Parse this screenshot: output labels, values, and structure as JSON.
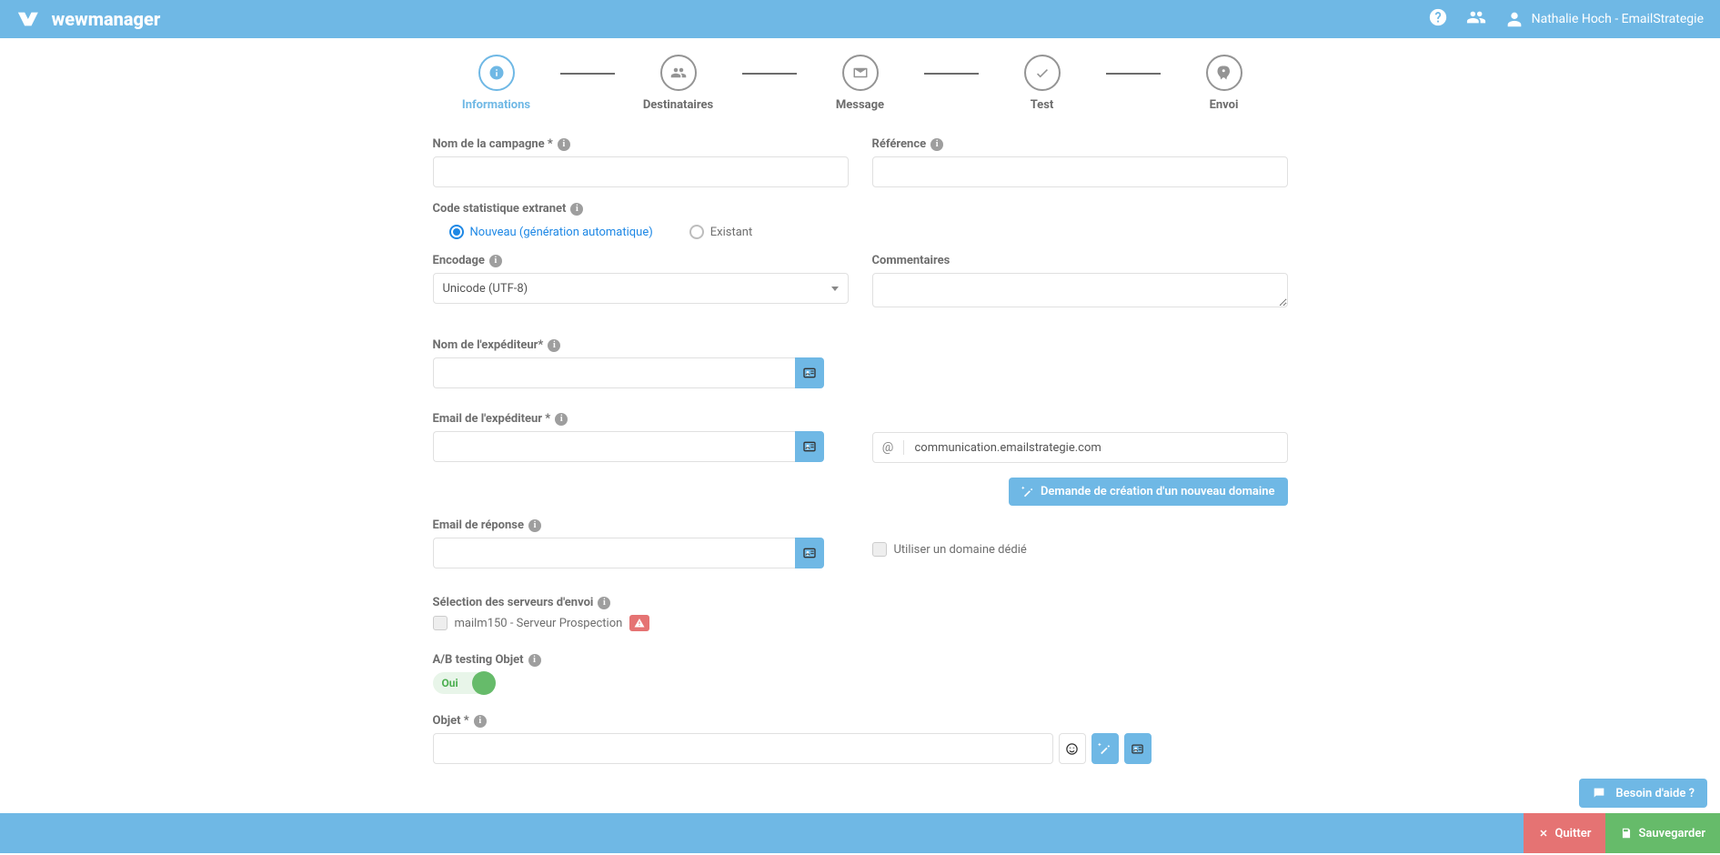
{
  "header": {
    "user_label": "Nathalie Hoch - EmailStrategie"
  },
  "stepper": {
    "steps": [
      {
        "label": "Informations",
        "icon": "info",
        "active": true
      },
      {
        "label": "Destinataires",
        "icon": "users",
        "active": false
      },
      {
        "label": "Message",
        "icon": "envelope",
        "active": false
      },
      {
        "label": "Test",
        "icon": "check",
        "active": false
      },
      {
        "label": "Envoi",
        "icon": "rocket",
        "active": false
      }
    ]
  },
  "form": {
    "campaign_name_label": "Nom de la campagne *",
    "campaign_name_value": "",
    "reference_label": "Référence",
    "reference_value": "",
    "stat_code_label": "Code statistique extranet",
    "stat_code_radio_new": "Nouveau (génération automatique)",
    "stat_code_radio_existing": "Existant",
    "encoding_label": "Encodage",
    "encoding_value": "Unicode (UTF-8)",
    "comments_label": "Commentaires",
    "comments_value": "",
    "sender_name_label": "Nom de l'expéditeur*",
    "sender_name_value": "",
    "sender_email_label": "Email de l'expéditeur *",
    "sender_email_value": "",
    "domain_at": "@",
    "domain_value": "communication.emailstrategie.com",
    "new_domain_btn": "Demande de création d'un nouveau domaine",
    "reply_email_label": "Email de réponse",
    "reply_email_value": "",
    "use_dedicated_domain": "Utiliser un domaine dédié",
    "servers_label": "Sélection des serveurs d'envoi",
    "server_item": "mailm150 - Serveur Prospection",
    "ab_label": "A/B testing Objet",
    "ab_value": "Oui",
    "subject_label": "Objet *",
    "subject_value": ""
  },
  "footer": {
    "help": "Besoin d'aide ?",
    "quit": "Quitter",
    "save": "Sauvegarder"
  }
}
